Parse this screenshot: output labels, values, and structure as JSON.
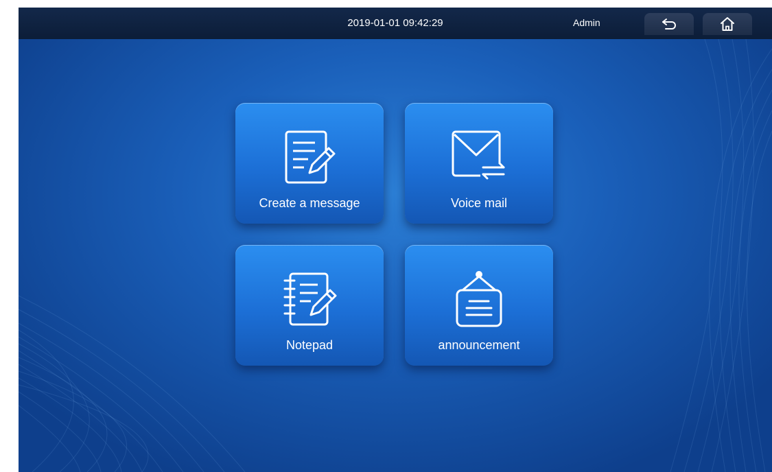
{
  "status_bar": {
    "datetime": "2019-01-01 09:42:29",
    "user": "Admin",
    "back_icon": "back-arrow-icon",
    "home_icon": "home-icon"
  },
  "menu": {
    "tiles": [
      {
        "label": "Create a message",
        "icon": "compose-message-icon"
      },
      {
        "label": "Voice mail",
        "icon": "envelope-transfer-icon"
      },
      {
        "label": "Notepad",
        "icon": "notepad-icon"
      },
      {
        "label": "announcement",
        "icon": "announcement-board-icon"
      }
    ]
  },
  "colors": {
    "background": "#1a5fb9",
    "tile": "#1c6fd6",
    "top_bar": "#0c1d38",
    "text": "#ffffff"
  }
}
